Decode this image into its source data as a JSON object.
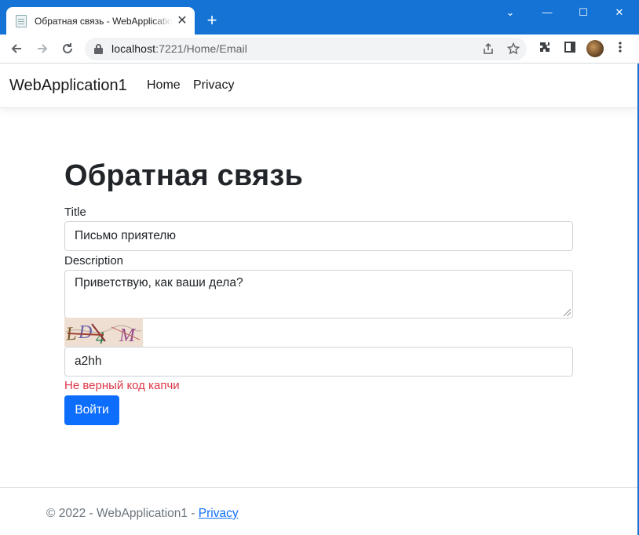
{
  "browser": {
    "tab_title": "Обратная связь - WebApplication1",
    "tab_close": "✕",
    "new_tab": "+",
    "url_host": "localhost",
    "url_path": ":7221/Home/Email",
    "window_controls": {
      "minimize": "—",
      "maximize": "☐",
      "close": "✕",
      "dropdown": "⌄"
    }
  },
  "navbar": {
    "brand": "WebApplication1",
    "links": [
      "Home",
      "Privacy"
    ]
  },
  "form": {
    "heading": "Обратная связь",
    "title_label": "Title",
    "title_value": "Письмо приятелю",
    "description_label": "Description",
    "description_value": "Приветствую, как ваши дела?",
    "captcha_text": "LD4 M",
    "captcha_input_value": "a2hh",
    "error_message": "Не верный код капчи",
    "submit_label": "Войти"
  },
  "footer": {
    "text": "© 2022 - WebApplication1 - ",
    "privacy_link": "Privacy"
  },
  "colors": {
    "titlebar": "#1473d4",
    "primary": "#0d6efd",
    "danger": "#dc3545",
    "muted": "#6c757d"
  },
  "icons": [
    "favicon-icon",
    "back-arrow-icon",
    "forward-arrow-icon",
    "reload-icon",
    "lock-icon",
    "share-icon",
    "star-icon",
    "extensions-icon",
    "sidepanel-icon",
    "menu-dots-icon"
  ]
}
